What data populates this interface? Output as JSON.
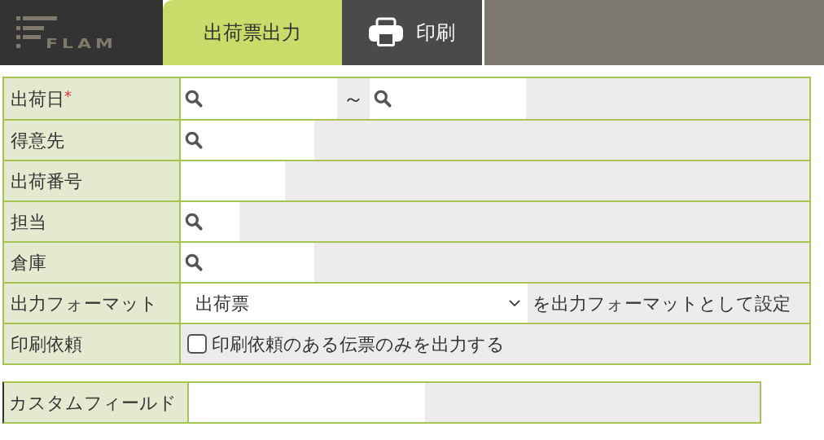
{
  "header": {
    "logo": "FLAM",
    "tabs": [
      {
        "label": "出荷票出力",
        "selected": true
      }
    ],
    "print_button": {
      "label": "印刷"
    }
  },
  "form": {
    "rows": [
      {
        "label": "出荷日",
        "required": "*",
        "kind": "range",
        "search": true,
        "separator": "～"
      },
      {
        "label": "得意先",
        "kind": "input",
        "search": true
      },
      {
        "label": "出荷番号",
        "kind": "input",
        "search": false
      },
      {
        "label": "担当",
        "kind": "input",
        "search": true
      },
      {
        "label": "倉庫",
        "kind": "input",
        "search": true
      },
      {
        "label": "出力フォーマット",
        "kind": "select",
        "value": "出荷票",
        "suffix": "を出力フォーマットとして設定"
      },
      {
        "label": "印刷依頼",
        "kind": "checkbox",
        "checked": false,
        "text": "印刷依頼のある伝票のみを出力する"
      }
    ]
  },
  "custom_field": {
    "label": "カスタムフィールド"
  }
}
